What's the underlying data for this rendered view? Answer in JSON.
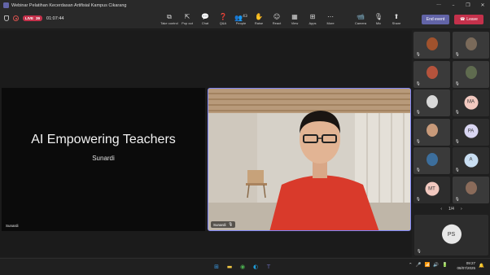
{
  "window": {
    "title": "Webinar Pelatihan Kecerdasan Artifisial Kampus Cikarang"
  },
  "status": {
    "live_label": "LIVE",
    "attendee_count": "39",
    "elapsed": "01:07:44"
  },
  "toolbar": {
    "tools": [
      {
        "label": "Take control",
        "icon": "take-control-icon",
        "glyph": "⧉"
      },
      {
        "label": "Pop out",
        "icon": "pop-out-icon",
        "glyph": "⇱"
      },
      {
        "label": "Chat",
        "icon": "chat-icon",
        "glyph": "💬"
      },
      {
        "label": "Q&A",
        "icon": "qa-icon",
        "glyph": "❓"
      },
      {
        "label": "People",
        "icon": "people-icon",
        "glyph": "👥",
        "badge": "43"
      },
      {
        "label": "Raise",
        "icon": "raise-hand-icon",
        "glyph": "✋"
      },
      {
        "label": "React",
        "icon": "react-icon",
        "glyph": "☺"
      },
      {
        "label": "View",
        "icon": "view-icon",
        "glyph": "▦"
      },
      {
        "label": "Apps",
        "icon": "apps-icon",
        "glyph": "⊞"
      },
      {
        "label": "More",
        "icon": "more-icon",
        "glyph": "⋯"
      }
    ],
    "media": [
      {
        "label": "Camera",
        "icon": "camera-icon",
        "glyph": "📹"
      },
      {
        "label": "Mic",
        "icon": "mic-off-icon",
        "glyph": "🎙"
      },
      {
        "label": "Share",
        "icon": "share-icon",
        "glyph": "⬆"
      }
    ],
    "end_event": "End event",
    "leave": "Leave",
    "accent": "#6264a7",
    "leave_color": "#c4314b"
  },
  "slide": {
    "title": "AI Empowering Teachers",
    "subtitle": "Sunardi",
    "presenter_label": "Sunardi"
  },
  "video": {
    "name": "Sunardi"
  },
  "gallery": {
    "tiles": [
      {
        "kind": "photo",
        "color": "#a0522d"
      },
      {
        "kind": "photo",
        "color": "#7a6a5a"
      },
      {
        "kind": "photo",
        "color": "#b5533c"
      },
      {
        "kind": "photo",
        "color": "#5f6b4f"
      },
      {
        "kind": "photo",
        "color": "#d8d8d8"
      },
      {
        "kind": "initials",
        "initials": "MA",
        "color": "#f2c9c0"
      },
      {
        "kind": "photo",
        "color": "#c89a7a"
      },
      {
        "kind": "initials",
        "initials": "PA",
        "color": "#d9d6f2"
      },
      {
        "kind": "photo",
        "color": "#3c6e9c"
      },
      {
        "kind": "initials",
        "initials": "A",
        "color": "#c9def2"
      },
      {
        "kind": "initials",
        "initials": "MT",
        "color": "#f2c9c0"
      },
      {
        "kind": "photo",
        "color": "#8a6b5a"
      }
    ],
    "pager": "1/4",
    "self_initials": "PS"
  },
  "taskbar": {
    "apps": [
      {
        "icon": "windows-start-icon",
        "glyph": "⊞",
        "color": "#3a96dd"
      },
      {
        "icon": "file-explorer-icon",
        "glyph": "▬",
        "color": "#f2c744"
      },
      {
        "icon": "chrome-icon",
        "glyph": "◉",
        "color": "#4caf50"
      },
      {
        "icon": "edge-icon",
        "glyph": "◐",
        "color": "#1e9bd7"
      },
      {
        "icon": "teams-icon",
        "glyph": "T",
        "color": "#6264a7"
      }
    ],
    "time": "09:27",
    "date": "08/07/2025"
  }
}
